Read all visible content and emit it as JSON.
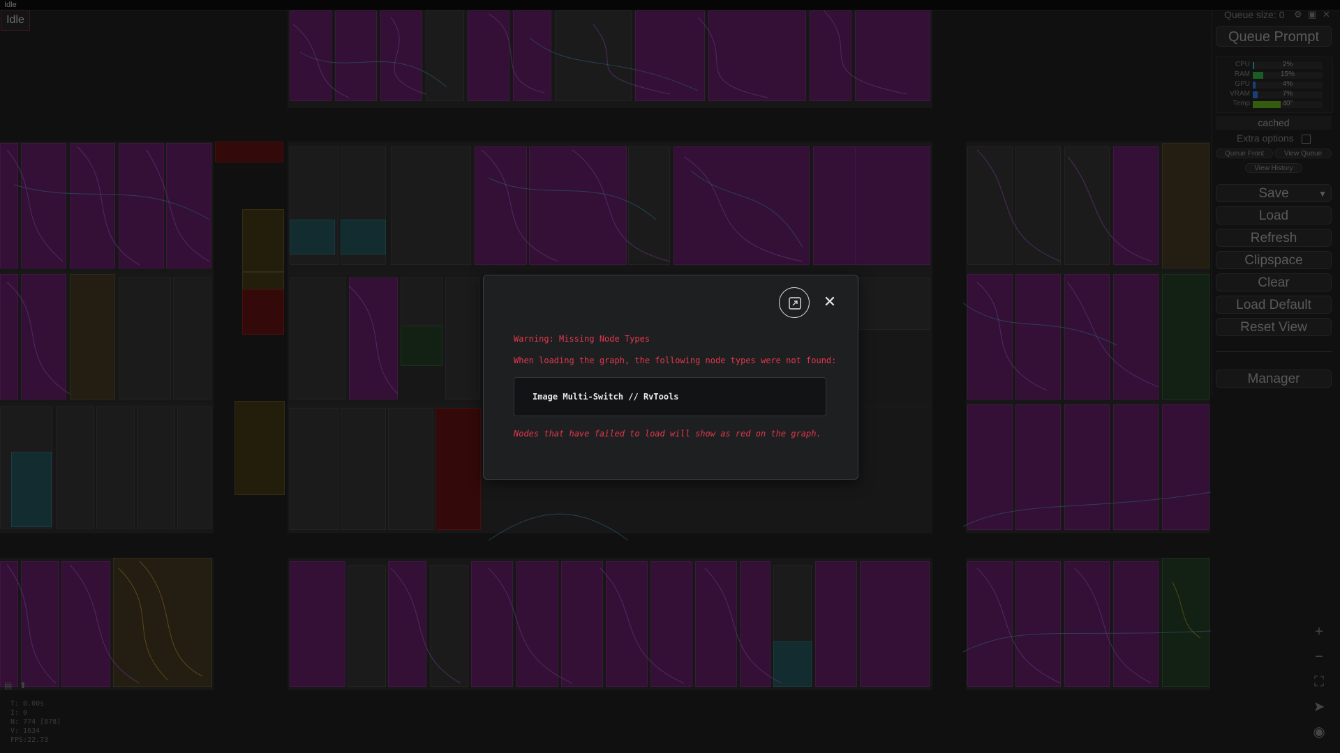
{
  "app": {
    "status_title": "Idle",
    "tab_label": "Idle"
  },
  "panel": {
    "queue_size": "Queue size: 0",
    "queue_prompt": "Queue Prompt",
    "stats": [
      {
        "label": "CPU",
        "value": "2%",
        "pct": 2,
        "color": "#2ea3d6"
      },
      {
        "label": "RAM",
        "value": "15%",
        "pct": 15,
        "color": "#2e9f3a"
      },
      {
        "label": "GPU",
        "value": "4%",
        "pct": 4,
        "color": "#2e6fd6"
      },
      {
        "label": "VRAM",
        "value": "7%",
        "pct": 7,
        "color": "#2e6fd6"
      },
      {
        "label": "Temp",
        "value": "40°",
        "pct": 40,
        "color": "#5a9f1a"
      }
    ],
    "cached": "cached",
    "extra_options": "Extra options",
    "queue_front": "Queue Front",
    "view_queue": "View Queue",
    "view_history": "View History",
    "save": "Save",
    "save_dropdown": "▼",
    "load": "Load",
    "refresh": "Refresh",
    "clipspace": "Clipspace",
    "clear": "Clear",
    "load_default": "Load Default",
    "reset_view": "Reset View",
    "manager": "Manager"
  },
  "canvas_info": {
    "t": "T: 0.00s",
    "i": "I: 0",
    "n": "N: 774 [878]",
    "v": "V: 1634",
    "fps": "FPS:22.73"
  },
  "icons": {
    "settings": "gear-icon",
    "image": "image-icon",
    "close_panel": "close-icon",
    "zoom_in": "plus-icon",
    "zoom_out": "minus-icon",
    "fit": "fit-view-icon",
    "arrow": "navigate-icon",
    "eye": "eye-icon"
  },
  "modal": {
    "title": "Warning: Missing Node Types",
    "description": "When loading the graph, the following node types were not found:",
    "missing_nodes": [
      "Image Multi-Switch // RvTools"
    ],
    "footer": "Nodes that have failed to load will show as red on the graph.",
    "close_symbol": "✕"
  }
}
